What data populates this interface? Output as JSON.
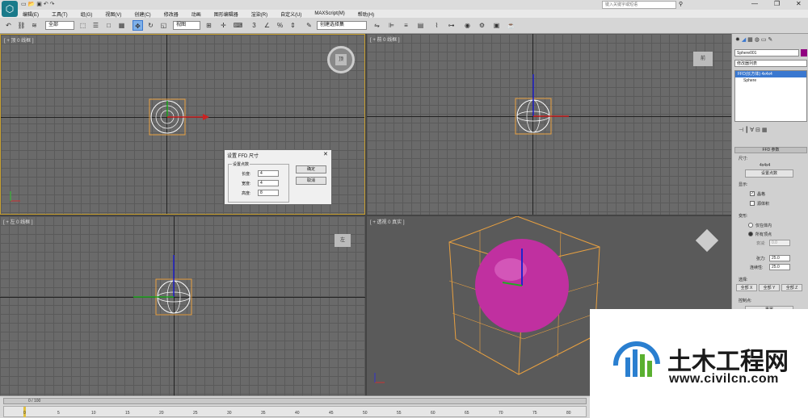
{
  "titlebar": {
    "search_placeholder": "键入关键字或短语"
  },
  "menu": [
    "编辑(E)",
    "工具(T)",
    "组(G)",
    "视图(V)",
    "创建(C)",
    "修改器",
    "动画",
    "图形编辑器",
    "渲染(R)",
    "自定义(U)",
    "MAXScript(M)",
    "帮助(H)"
  ],
  "toolbar": {
    "filter_value": "全部",
    "view_value": "视图",
    "selection_set": "创建选择集"
  },
  "viewports": {
    "top": "[ + 顶 0 线框 ]",
    "front": "[ + 前 0 线框 ]",
    "left": "[ + 左 0 线框 ]",
    "persp": "[ + 透视 0 真实 ]",
    "cube_top": "顶",
    "cube_front": "前",
    "cube_left": "左"
  },
  "dialog": {
    "title": "设置 FFD 尺寸",
    "group": "设置点数",
    "length_label": "长度:",
    "length_value": "4",
    "width_label": "宽度:",
    "width_value": "4",
    "height_label": "高度:",
    "height_value": "8",
    "ok": "确定",
    "cancel": "取消"
  },
  "panel": {
    "object_name": "Sphere001",
    "modifier_list": "修改器列表",
    "stack_ffd": "FFD(长方体) 4x4x4",
    "stack_sphere": "Sphere",
    "rollout_title": "FFD 参数",
    "size_label": "尺寸:",
    "size_value": "4x4x4",
    "set_points_btn": "设置点数",
    "display_label": "显示:",
    "lattice_label": "晶格",
    "source_volume_label": "源体积",
    "deform_label": "变形:",
    "only_in_volume": "仅在体内",
    "all_vertices": "所有顶点",
    "falloff_label": "衰减:",
    "falloff_value": "0.0",
    "tension_label": "张力:",
    "tension_value": "25.0",
    "continuity_label": "连续性:",
    "continuity_value": "25.0",
    "select_label": "选择:",
    "all_x": "全部 X",
    "all_y": "全部 Y",
    "all_z": "全部 Z",
    "control_points_label": "控制点:",
    "reset_btn": "重置"
  },
  "timeline": {
    "frame_counter": "0 / 100",
    "ticks": [
      "0",
      "5",
      "10",
      "15",
      "20",
      "25",
      "30",
      "35",
      "40",
      "45",
      "50",
      "55",
      "60",
      "65",
      "70",
      "75",
      "80"
    ]
  },
  "watermark": {
    "brand": "土木工程网",
    "url": "www.civilcn.com"
  },
  "colors": {
    "selection_yellow": "#c8a030",
    "sphere_magenta": "#c030a0",
    "lattice_orange": "#e8a040",
    "accent_blue": "#3a78d0"
  }
}
